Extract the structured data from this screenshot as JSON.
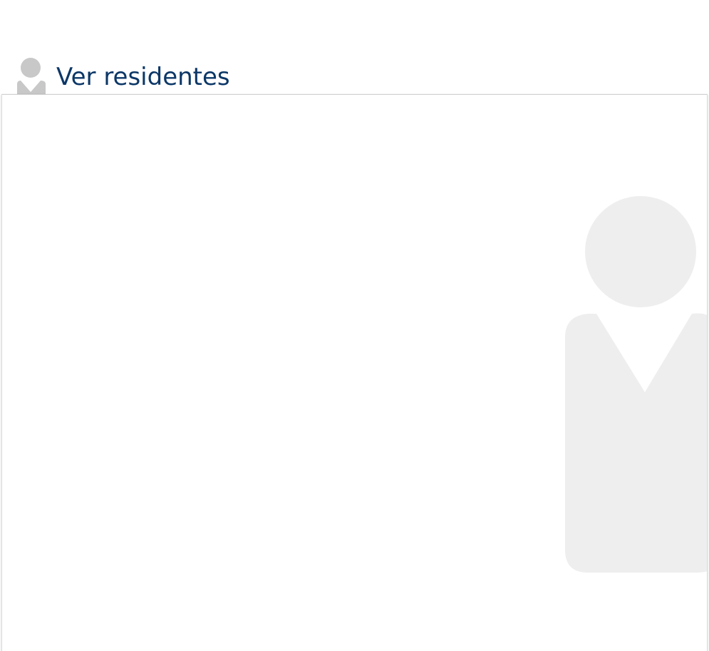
{
  "header": {
    "title": "Ver residentes",
    "icon": "person-icon"
  },
  "content": {
    "watermark_icon": "person-watermark-icon"
  },
  "colors": {
    "title": "#0c3767",
    "header_icon": "#c8c8c8",
    "watermark": "#eeeeee",
    "panel_border": "#dcdcdc"
  }
}
